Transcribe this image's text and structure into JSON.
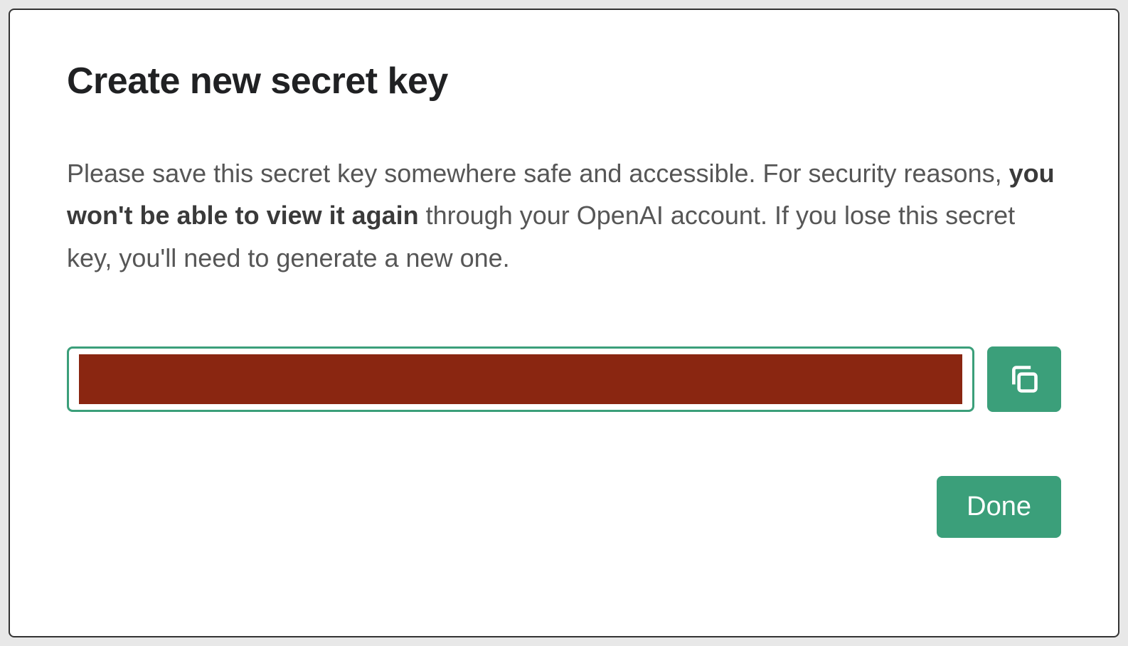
{
  "modal": {
    "title": "Create new secret key",
    "description_part1": "Please save this secret key somewhere safe and accessible. For security reasons, ",
    "description_bold": "you won't be able to view it again",
    "description_part2": " through your OpenAI account. If you lose this secret key, you'll need to generate a new one.",
    "secret_key_value": "",
    "done_button_label": "Done"
  },
  "colors": {
    "accent": "#3b9f7a",
    "redaction": "#8a2611"
  }
}
